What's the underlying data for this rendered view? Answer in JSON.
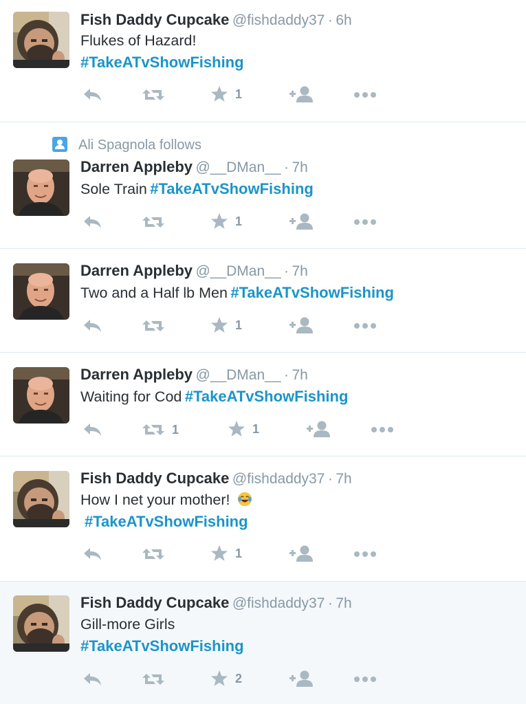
{
  "tweets": [
    {
      "name": "Fish Daddy Cupcake",
      "handle": "@fishdaddy37",
      "sep": "·",
      "time": "6h",
      "line1": "Flukes of Hazard!",
      "line2": "#TakeATvShowFishing",
      "likes": "1",
      "retweets": ""
    },
    {
      "context": "Ali Spagnola follows",
      "name": "Darren Appleby",
      "handle": "@__DMan__",
      "sep": "·",
      "time": "7h",
      "text": "Sole Train",
      "hashtag": "#TakeATvShowFishing",
      "likes": "1",
      "retweets": ""
    },
    {
      "name": "Darren Appleby",
      "handle": "@__DMan__",
      "sep": "·",
      "time": "7h",
      "text": "Two and a Half lb Men",
      "hashtag": "#TakeATvShowFishing",
      "likes": "1",
      "retweets": ""
    },
    {
      "name": "Darren Appleby",
      "handle": "@__DMan__",
      "sep": "·",
      "time": "7h",
      "text": "Waiting for Cod",
      "hashtag": "#TakeATvShowFishing",
      "likes": "1",
      "retweets": "1"
    },
    {
      "name": "Fish Daddy Cupcake",
      "handle": "@fishdaddy37",
      "sep": "·",
      "time": "7h",
      "line1": "How I net your mother!",
      "emoji": "laughing-crying-emoji",
      "line2": "#TakeATvShowFishing",
      "likes": "1",
      "retweets": ""
    },
    {
      "name": "Fish Daddy Cupcake",
      "handle": "@fishdaddy37",
      "sep": "·",
      "time": "7h",
      "line1": "Gill-more Girls",
      "line2": "#TakeATvShowFishing",
      "likes": "2",
      "retweets": ""
    }
  ],
  "colors": {
    "hashtag": "#1b95c9",
    "muted": "#8899a6",
    "icon": "#aab8c2",
    "highlight": "#f5f8fa",
    "context_icon": "#4aa5e6"
  },
  "icons": [
    "reply-icon",
    "retweet-icon",
    "like-star-icon",
    "follow-icon",
    "more-icon",
    "person-icon"
  ]
}
